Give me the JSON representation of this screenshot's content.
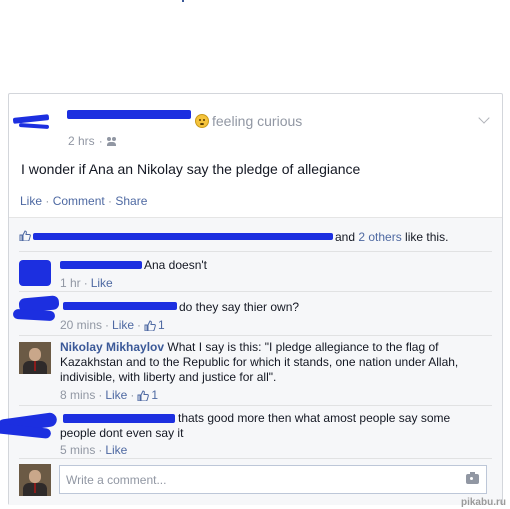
{
  "post": {
    "feeling": "feeling curious",
    "time": "2 hrs",
    "meta_sep": "·",
    "text": "I wonder if Ana an Nikolay say the pledge of allegiance",
    "actions": {
      "like": "Like",
      "comment": "Comment",
      "share": "Share",
      "sep": " · "
    }
  },
  "likes": {
    "others_link": "2 others",
    "prefix": "and ",
    "suffix": " like this."
  },
  "comments": [
    {
      "text": "Ana doesn't",
      "time": "1 hr",
      "like": "Like"
    },
    {
      "text": "do they say thier own?",
      "time": "20 mins",
      "like": "Like",
      "like_count": "1"
    },
    {
      "author": "Nikolay Mikhaylov",
      "text": " What I say is this: \"I pledge allegiance to the flag of Kazakhstan and to the Republic for which it stands, one nation under Allah, indivisible, with liberty and justice for all\".",
      "time": "8 mins",
      "like": "Like",
      "like_count": "1"
    },
    {
      "text": "thats good more then what amost people say some people dont even say it",
      "time": "5 mins",
      "like": "Like"
    }
  ],
  "composer": {
    "placeholder": "Write a comment..."
  },
  "watermark": "pikabu.ru",
  "colors": {
    "link": "#4e69a2",
    "redaction": "#1c2fe0",
    "border": "#d3d6db",
    "ufi_bg": "#f6f7f9"
  }
}
